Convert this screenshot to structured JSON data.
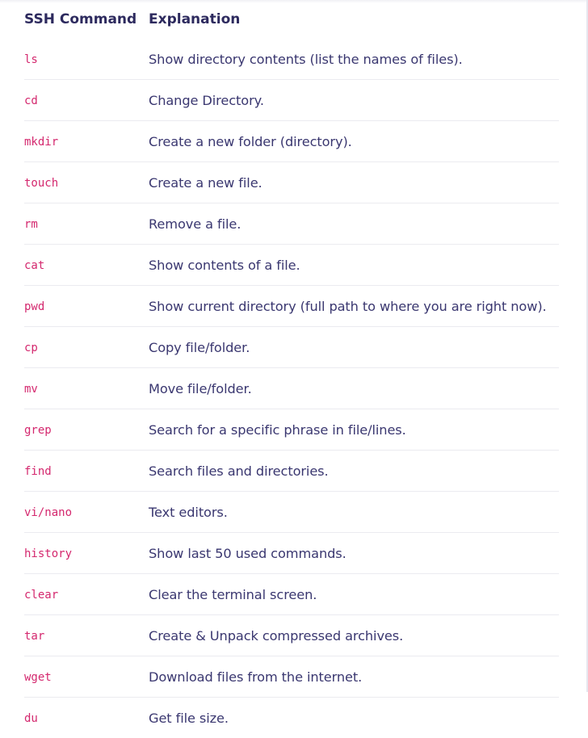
{
  "table": {
    "headers": {
      "command": "SSH Command",
      "explanation": "Explanation"
    },
    "rows": [
      {
        "command": "ls",
        "explanation": "Show directory contents (list the names of files)."
      },
      {
        "command": "cd",
        "explanation": "Change Directory."
      },
      {
        "command": "mkdir",
        "explanation": "Create a new folder (directory)."
      },
      {
        "command": "touch",
        "explanation": "Create a new file."
      },
      {
        "command": "rm",
        "explanation": "Remove a file."
      },
      {
        "command": "cat",
        "explanation": "Show contents of a file."
      },
      {
        "command": "pwd",
        "explanation": "Show current directory (full path to where you are right now)."
      },
      {
        "command": "cp",
        "explanation": "Copy file/folder."
      },
      {
        "command": "mv",
        "explanation": "Move file/folder."
      },
      {
        "command": "grep",
        "explanation": "Search for a specific phrase in file/lines."
      },
      {
        "command": "find",
        "explanation": "Search files and directories."
      },
      {
        "command": "vi/nano",
        "explanation": "Text editors."
      },
      {
        "command": "history",
        "explanation": "Show last 50 used commands."
      },
      {
        "command": "clear",
        "explanation": "Clear the terminal screen."
      },
      {
        "command": "tar",
        "explanation": "Create & Unpack compressed archives."
      },
      {
        "command": "wget",
        "explanation": "Download files from the internet."
      },
      {
        "command": "du",
        "explanation": "Get file size."
      }
    ]
  },
  "colors": {
    "header_text": "#2d2a5e",
    "command_text": "#d4286e",
    "explanation_text": "#3a3770",
    "row_divider": "#ebebf0"
  }
}
